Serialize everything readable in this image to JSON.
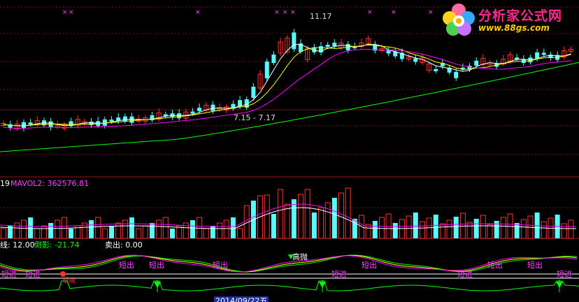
{
  "price_panel": {
    "high_annotation": "11.17",
    "range_annotation": "7.15 - 7.17"
  },
  "volume_panel": {
    "left_fragment": "19",
    "mavol2_label": "MAVOL2: 362576.81"
  },
  "indicator_panel": {
    "field1": "线: 12.00",
    "field2": "倒影: -21.74",
    "field3": "卖出: 0.00",
    "signal_high_sell": "高抛",
    "signal_short_out": "短出",
    "signal_short_in": "短进",
    "signal_low_buy": "低吸"
  },
  "date_fragment": "2014/09/22五",
  "logo": {
    "title": "分析家公式网",
    "url": "www.88gs.com"
  },
  "colors": {
    "up_candle": "#ff3232",
    "down_candle": "#54ffff",
    "ma_white": "#ffffff",
    "ma_yellow": "#ffff00",
    "ma_magenta": "#ff00ff",
    "ma_green": "#00ff00",
    "panel_divider": "#a01010"
  }
}
